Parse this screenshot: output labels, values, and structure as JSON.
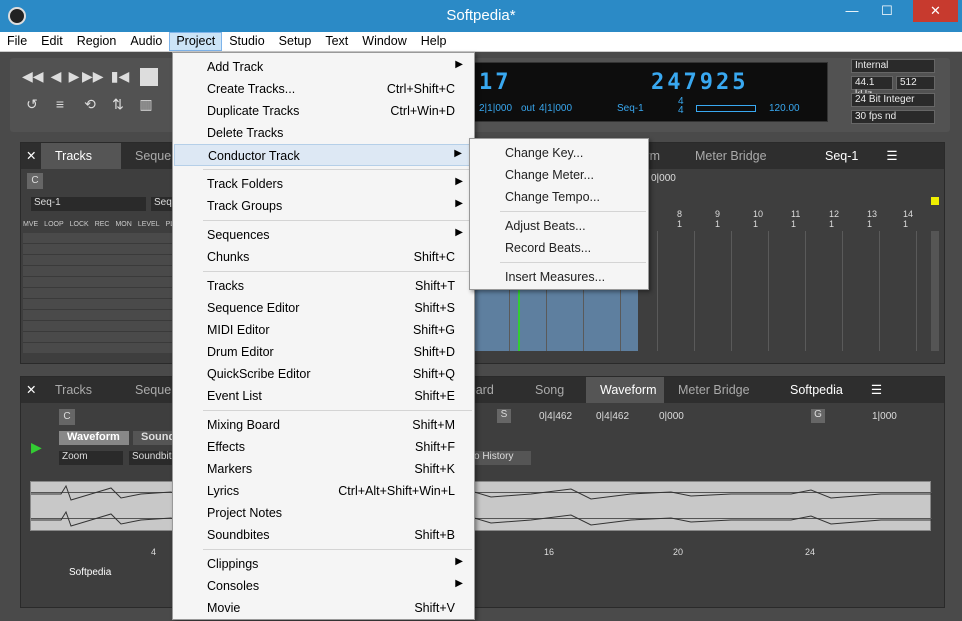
{
  "window": {
    "title": "Softpedia*",
    "minimize": "—",
    "maximize": "☐",
    "close": "✕"
  },
  "menubar": [
    "File",
    "Edit",
    "Region",
    "Audio",
    "Project",
    "Studio",
    "Setup",
    "Text",
    "Window",
    "Help"
  ],
  "counter": {
    "left_big": "17",
    "right_big": "247925",
    "out_label": "out",
    "out_val": "4|1|000",
    "left_small": "2|1|000",
    "seq_label": "Seq-1",
    "tempo": "120.00",
    "meter_top": "4",
    "meter_bottom": "4"
  },
  "right_info": {
    "sync": "Internal",
    "rate": "44.1 kHz",
    "buffer": "512",
    "bit": "24 Bit Integer",
    "fps": "30 fps nd"
  },
  "top_panel": {
    "tabs": [
      "Tracks",
      "Sequen",
      "form",
      "Meter Bridge"
    ],
    "seq_menu": "Seq-1",
    "c_btn": "C",
    "seq_name": "Seq-1",
    "seq_name2": "Seq-",
    "cols": [
      "MVE",
      "LOOP",
      "LOCK",
      "REC",
      "MON",
      "LEVEL",
      "PLAY"
    ],
    "bar_nums": [
      "8",
      "9",
      "10",
      "11",
      "12",
      "13",
      "14"
    ],
    "bar_sub": "1",
    "time_readout": "0|000"
  },
  "bottom_panel": {
    "tabs": [
      "Tracks",
      "Sequen",
      "g Board",
      "Song",
      "Waveform",
      "Meter Bridge"
    ],
    "menu": "Softpedia",
    "c_btn": "C",
    "sub_tabs": [
      "Waveform",
      "Sound"
    ],
    "zoom": "Zoom",
    "soundbite": "Soundbite",
    "history": "o History",
    "s_btn": "S",
    "pos1": "0|4|462",
    "pos2": "0|4|462",
    "pos3": "0|000",
    "g_btn": "G",
    "g_val": "1|000",
    "ruler": [
      "4",
      "16",
      "20",
      "24"
    ],
    "track_label": "Softpedia"
  },
  "project_menu": [
    {
      "label": "Add Track",
      "sc": "",
      "sub": true
    },
    {
      "label": "Create Tracks...",
      "sc": "Ctrl+Shift+C"
    },
    {
      "label": "Duplicate Tracks",
      "sc": "Ctrl+Win+D"
    },
    {
      "label": "Delete Tracks",
      "sc": ""
    },
    {
      "label": "Conductor Track",
      "sc": "",
      "sub": true
    },
    {
      "label": "Track Folders",
      "sc": "",
      "sub": true
    },
    {
      "label": "Track Groups",
      "sc": "",
      "sub": true
    },
    {
      "label": "Sequences",
      "sc": "",
      "sub": true
    },
    {
      "label": "Chunks",
      "sc": "Shift+C"
    },
    {
      "label": "Tracks",
      "sc": "Shift+T"
    },
    {
      "label": "Sequence Editor",
      "sc": "Shift+S"
    },
    {
      "label": "MIDI Editor",
      "sc": "Shift+G"
    },
    {
      "label": "Drum Editor",
      "sc": "Shift+D"
    },
    {
      "label": "QuickScribe Editor",
      "sc": "Shift+Q"
    },
    {
      "label": "Event List",
      "sc": "Shift+E"
    },
    {
      "label": "Mixing Board",
      "sc": "Shift+M"
    },
    {
      "label": "Effects",
      "sc": "Shift+F"
    },
    {
      "label": "Markers",
      "sc": "Shift+K"
    },
    {
      "label": "Lyrics",
      "sc": "Ctrl+Alt+Shift+Win+L"
    },
    {
      "label": "Project Notes",
      "sc": ""
    },
    {
      "label": "Soundbites",
      "sc": "Shift+B"
    },
    {
      "label": "Clippings",
      "sc": "",
      "sub": true
    },
    {
      "label": "Consoles",
      "sc": "",
      "sub": true
    },
    {
      "label": "Movie",
      "sc": "Shift+V"
    }
  ],
  "conductor_submenu": [
    "Change Key...",
    "Change Meter...",
    "Change Tempo...",
    "Adjust Beats...",
    "Record Beats...",
    "Insert Measures..."
  ]
}
